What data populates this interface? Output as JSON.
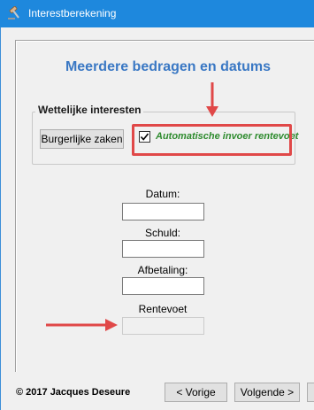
{
  "window": {
    "title": "Interestberekening",
    "icon": "gavel-icon",
    "accent_color": "#1e88dd"
  },
  "heading": "Meerdere bedragen en datums",
  "legal_interest_group": {
    "legend": "Wettelijke interesten",
    "civil_button_label": "Burgerlijke zaken",
    "auto_rate_checkbox": {
      "label": "Automatische invoer rentevoet",
      "checked": true,
      "label_color": "#2e8b2e"
    }
  },
  "fields": {
    "datum": {
      "label": "Datum:",
      "value": ""
    },
    "schuld": {
      "label": "Schuld:",
      "value": ""
    },
    "afbetaling": {
      "label": "Afbetaling:",
      "value": ""
    },
    "rentevoet": {
      "label": "Rentevoet",
      "value": "",
      "disabled": true
    }
  },
  "annotations": {
    "highlight_color": "#e04848"
  },
  "footer": {
    "copyright": "© 2017 Jacques Deseure",
    "prev_label": "< Vorige",
    "next_label": "Volgende >"
  }
}
